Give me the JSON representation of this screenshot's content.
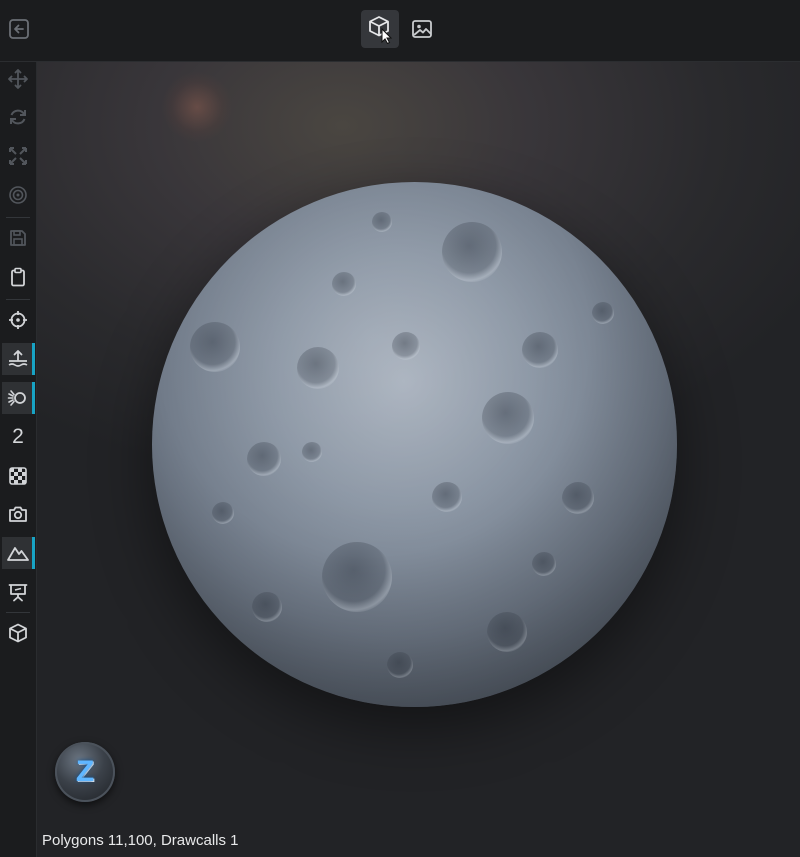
{
  "topbar": {
    "back_icon": "back-icon",
    "modes": [
      {
        "icon": "cube-3d-icon",
        "active": true
      },
      {
        "icon": "image-icon",
        "active": false
      }
    ]
  },
  "sidebar": {
    "tools": [
      {
        "icon": "move-icon",
        "disabled": true
      },
      {
        "icon": "rotate-icon",
        "disabled": true
      },
      {
        "icon": "scale-icon",
        "disabled": true
      },
      {
        "icon": "target-rings-icon",
        "disabled": true
      },
      {
        "icon": "save-icon",
        "disabled": true
      },
      {
        "icon": "clipboard-icon"
      },
      {
        "icon": "crosshair-icon"
      },
      {
        "icon": "upload-water-icon",
        "active": true
      },
      {
        "icon": "light-gear-icon",
        "active": true
      },
      {
        "icon": "number-label",
        "label": "2"
      },
      {
        "icon": "checker-icon"
      },
      {
        "icon": "camera-icon"
      },
      {
        "icon": "mountain-icon",
        "active": true
      },
      {
        "icon": "presentation-icon"
      },
      {
        "icon": "cube-icon"
      }
    ],
    "accent_color": "#18a3c4"
  },
  "viewport": {
    "logo_letter": "Z",
    "stats": "Polygons 11,100, Drawcalls 1"
  }
}
